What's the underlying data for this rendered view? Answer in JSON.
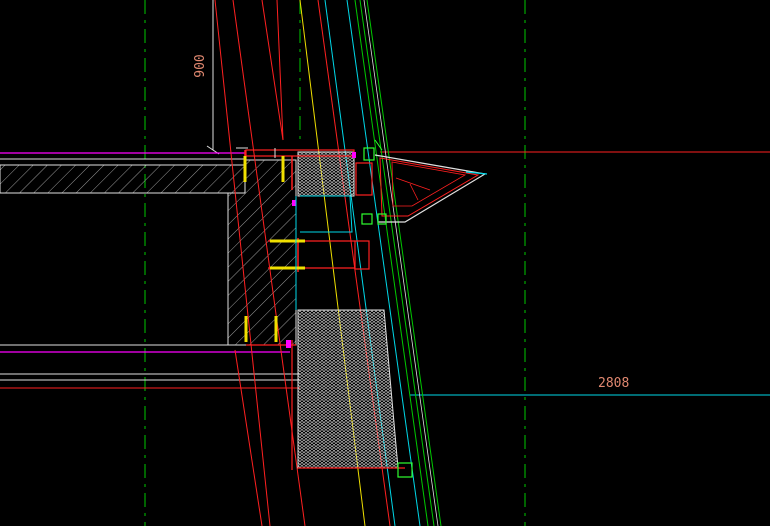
{
  "drawing": {
    "dimension_vertical": "900",
    "dimension_horizontal": "2808"
  },
  "colors": {
    "background": "#000000",
    "axis_green": "#00c800",
    "line_red": "#ff2020",
    "dim_text": "#e08870",
    "cyan": "#00d8e8",
    "yellow": "#f0e000",
    "magenta": "#ff00ff",
    "white": "#e0e0e0",
    "hatch": "#b8b8b8",
    "green_bright": "#30ff30"
  }
}
